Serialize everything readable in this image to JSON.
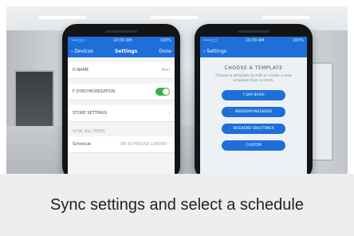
{
  "caption": "Sync settings and select a schedule",
  "phone_left": {
    "status_left": "•••○○",
    "status_center": "10:09 AM",
    "status_right": "100%",
    "back_label": "Devices",
    "title": "Settings",
    "action": "Done",
    "rows": [
      {
        "label": "D-NAME",
        "value": "Kexi"
      },
      {
        "label": "F-SYNCHRONIZATION",
        "value": ""
      },
      {
        "label": "STORE SETTINGS",
        "value": "›"
      }
    ],
    "section_label": "SYNC ALL ITEMS",
    "section_row_label": "Schedule",
    "section_row_value": "DR SCHEDULE LOADED ›"
  },
  "phone_right": {
    "status_left": "•••○○",
    "status_center": "10:09 AM",
    "status_right": "100%",
    "back_label": "Settings",
    "heading": "CHOOSE A TEMPLATE",
    "subtext": "Choose a template to edit or create a new schedule from scratch.",
    "buttons": [
      "7 DAY BASIC",
      "WEEKDAY/WEEKEND",
      "WEEKEND ONLY/TIMER",
      "CUSTOM"
    ]
  },
  "colors": {
    "accent": "#1e6fd9",
    "toggle_on": "#38b24a",
    "caption_bg": "#eeeeee"
  }
}
